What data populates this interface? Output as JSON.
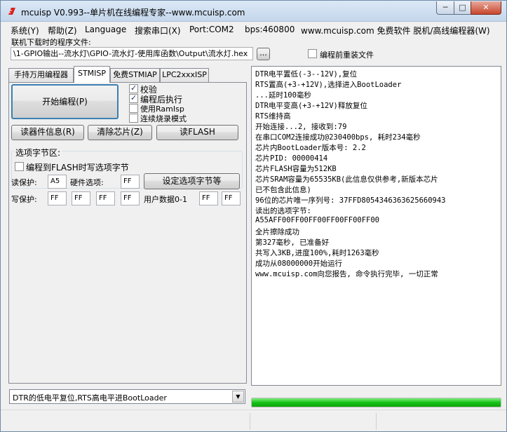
{
  "window": {
    "title": "mcuisp V0.993--单片机在线编程专家--www.mcuisp.com",
    "minimize": "─",
    "maximize": "□",
    "close": "✕"
  },
  "menu": [
    "系统(Y)",
    "帮助(Z)",
    "Language",
    "搜索串口(X)",
    "Port:COM2",
    "bps:460800",
    "www.mcuisp.com 免费软件 脱机/高线编程器(W)"
  ],
  "file": {
    "label": "联机下载时的程序文件:",
    "path": "\\1-GPIO输出--流水灯\\GPIO-流水灯-使用库函数\\Output\\流水灯.hex",
    "browse_label": "...",
    "reload_label": "编程前重装文件",
    "reload_checked": false
  },
  "tabs": [
    {
      "label": "手持万用编程器",
      "active": false
    },
    {
      "label": "STMISP",
      "active": true
    },
    {
      "label": "免费STMIAP",
      "active": false
    },
    {
      "label": "LPC2xxxISP",
      "active": false
    }
  ],
  "stmisp": {
    "start_button": "开始编程(P)",
    "options": [
      {
        "label": "校验",
        "checked": true
      },
      {
        "label": "编程后执行",
        "checked": true
      },
      {
        "label": "使用RamIsp",
        "checked": false
      },
      {
        "label": "连续烧录模式",
        "checked": false
      }
    ],
    "read_info_button": "读器件信息(R)",
    "erase_button": "清除芯片(Z)",
    "read_flash_button": "读FLASH",
    "option_bytes": {
      "title": "选项字节区:",
      "write_with_flash_label": "编程到FLASH时写选项字节",
      "write_with_flash_checked": false,
      "read_protect_label": "读保护:",
      "read_protect_value": "A5",
      "hw_option_label": "硬件选项:",
      "hw_option_value": "FF",
      "set_button": "设定选项字节等",
      "write_protect_label": "写保护:",
      "write_protect_values": [
        "FF",
        "FF",
        "FF",
        "FF"
      ],
      "user_data_label": "用户数据0-1",
      "user_data_values": [
        "FF",
        "FF"
      ]
    }
  },
  "reset_mode": {
    "selected": "DTR的低电平复位,RTS高电平进BootLoader",
    "arrow": "▼"
  },
  "log": [
    "DTR电平置低(-3--12V),复位",
    "RTS置高(+3-+12V),选择进入BootLoader",
    "...延时100毫秒",
    "DTR电平变高(+3-+12V)释放复位",
    "RTS维持高",
    "开始连接...2, 接收到:79",
    "在串口COM2连接成功@230400bps, 耗时234毫秒",
    "芯片内BootLoader版本号: 2.2",
    "芯片PID: 00000414",
    "芯片FLASH容量为512KB",
    "芯片SRAM容量为65535KB(此信息仅供参考,新版本芯片",
    "已不包含此信息)",
    "96位的芯片唯一序列号: 37FFD8054346363625660943",
    "读出的选项字节:",
    "A55AFF00FF00FF00FF00FF00FF00",
    "全片擦除成功",
    "第327毫秒, 已准备好",
    "共写入3KB,进度100%,耗时1263毫秒",
    "成功从08000000开始运行",
    "www.mcuisp.com向您报告, 命令执行完毕, 一切正常"
  ],
  "progress": {
    "percent": 100,
    "color": "#16c116"
  },
  "colors": {
    "app_icon": "#d8231f",
    "title_bar": "#c5d7ec"
  }
}
